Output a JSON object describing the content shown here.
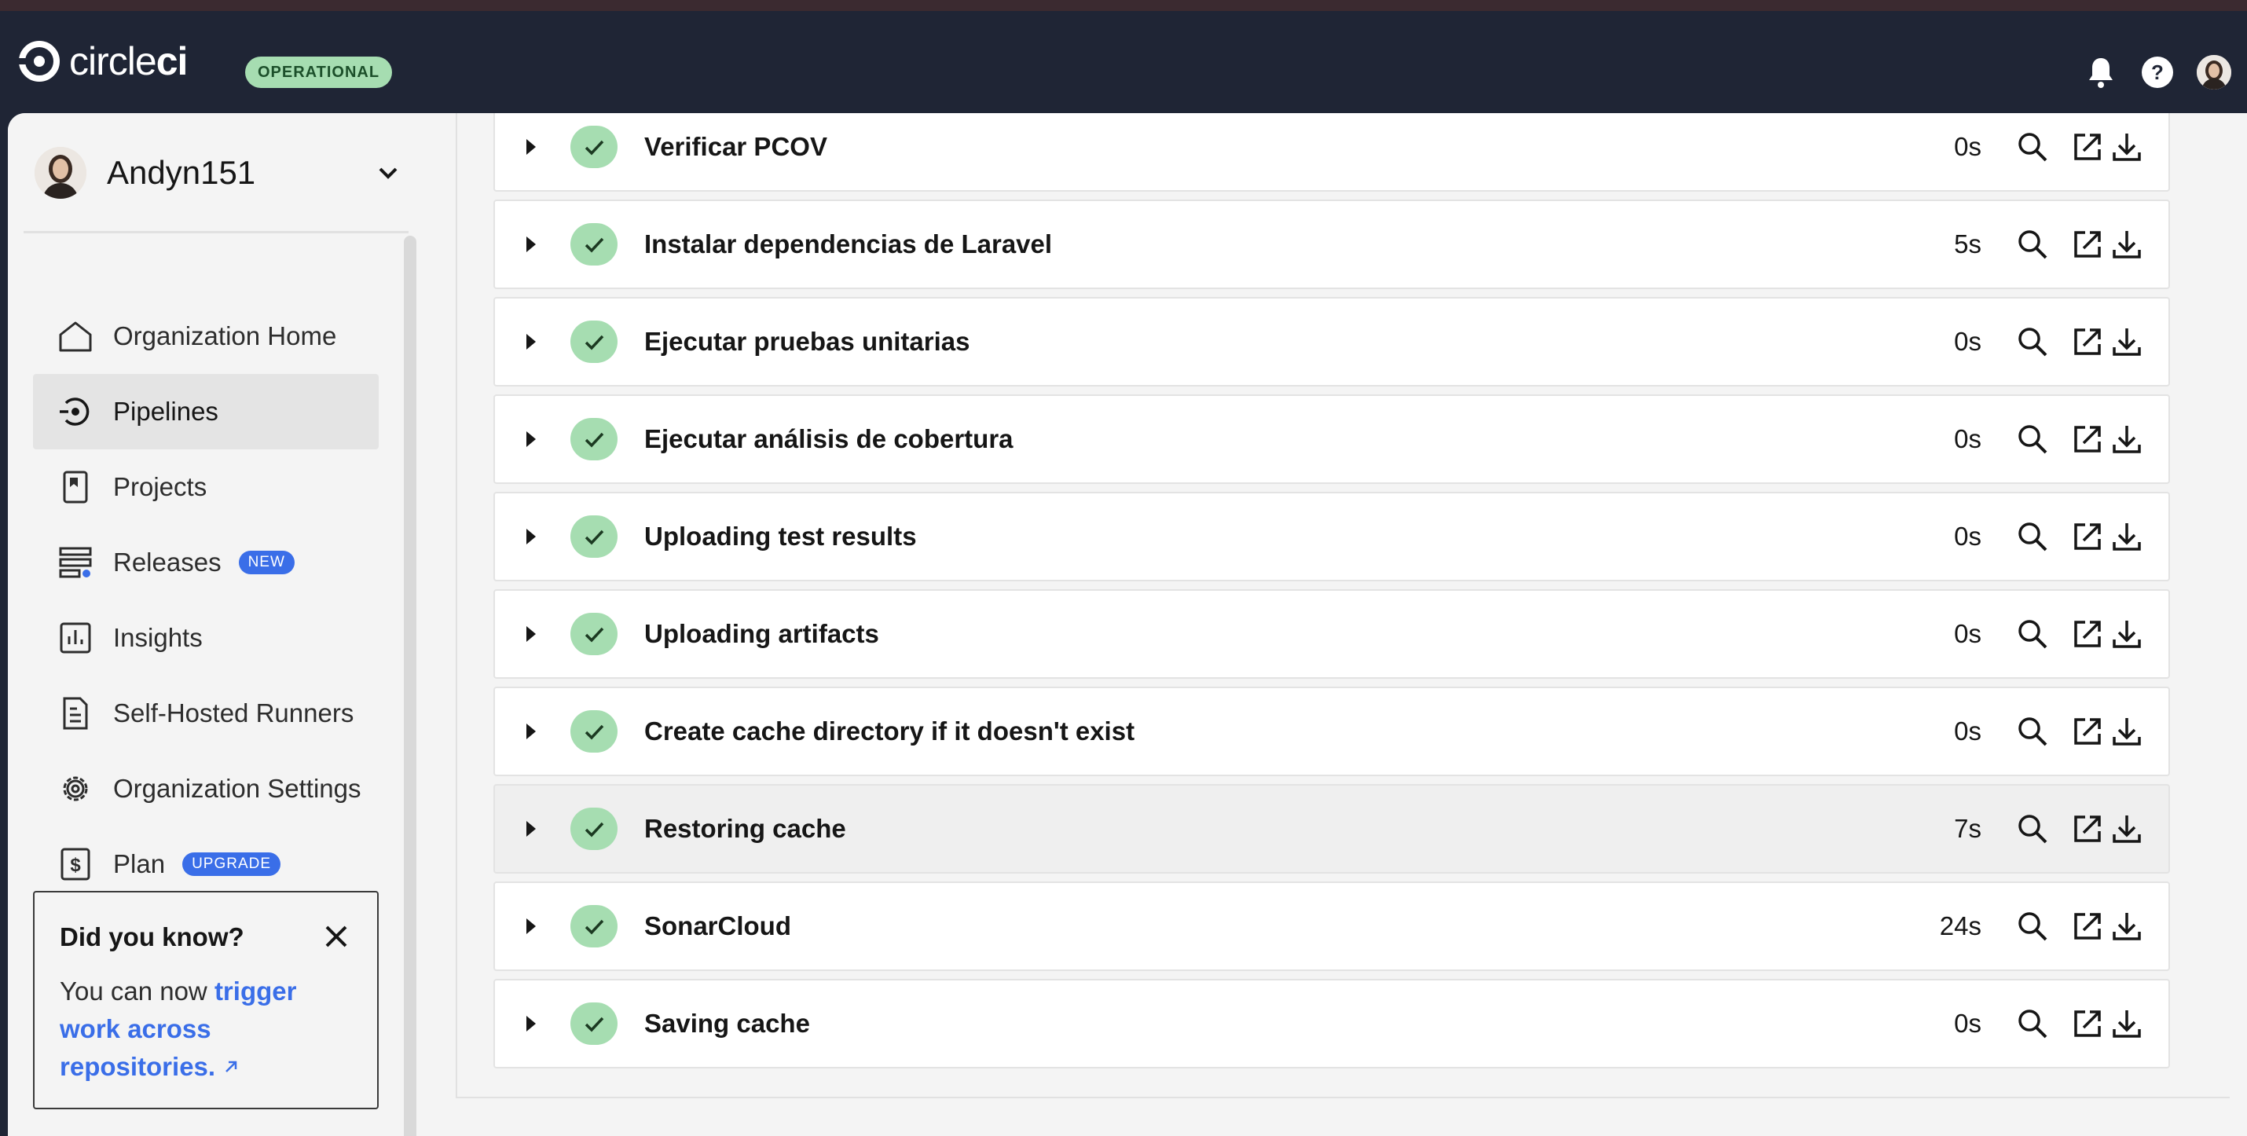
{
  "topbar": {
    "logo_text_light": "circle",
    "logo_text_bold": "ci",
    "status": "OPERATIONAL"
  },
  "sidebar": {
    "org_name": "Andyn151",
    "items": [
      {
        "label": "Organization Home",
        "icon": "home-icon"
      },
      {
        "label": "Pipelines",
        "icon": "pipelines-icon",
        "active": true
      },
      {
        "label": "Projects",
        "icon": "projects-icon"
      },
      {
        "label": "Releases",
        "icon": "releases-icon",
        "badge": "NEW"
      },
      {
        "label": "Insights",
        "icon": "insights-icon"
      },
      {
        "label": "Self-Hosted Runners",
        "icon": "runners-icon"
      },
      {
        "label": "Organization Settings",
        "icon": "gear-icon"
      },
      {
        "label": "Plan",
        "icon": "plan-icon",
        "badge": "UPGRADE"
      }
    ],
    "tip": {
      "title": "Did you know?",
      "text": "You can now ",
      "link": "trigger work across repositories."
    }
  },
  "steps": [
    {
      "name": "Verificar PCOV",
      "duration": "0s"
    },
    {
      "name": "Instalar dependencias de Laravel",
      "duration": "5s"
    },
    {
      "name": "Ejecutar pruebas unitarias",
      "duration": "0s"
    },
    {
      "name": "Ejecutar análisis de cobertura",
      "duration": "0s"
    },
    {
      "name": "Uploading test results",
      "duration": "0s"
    },
    {
      "name": "Uploading artifacts",
      "duration": "0s"
    },
    {
      "name": "Create cache directory if it doesn't exist",
      "duration": "0s"
    },
    {
      "name": "Restoring cache",
      "duration": "7s",
      "highlighted": true
    },
    {
      "name": "SonarCloud",
      "duration": "24s"
    },
    {
      "name": "Saving cache",
      "duration": "0s"
    }
  ],
  "colors": {
    "topbar": "#1f2535",
    "success": "#a6ddb1",
    "accent": "#3a6ee8"
  }
}
